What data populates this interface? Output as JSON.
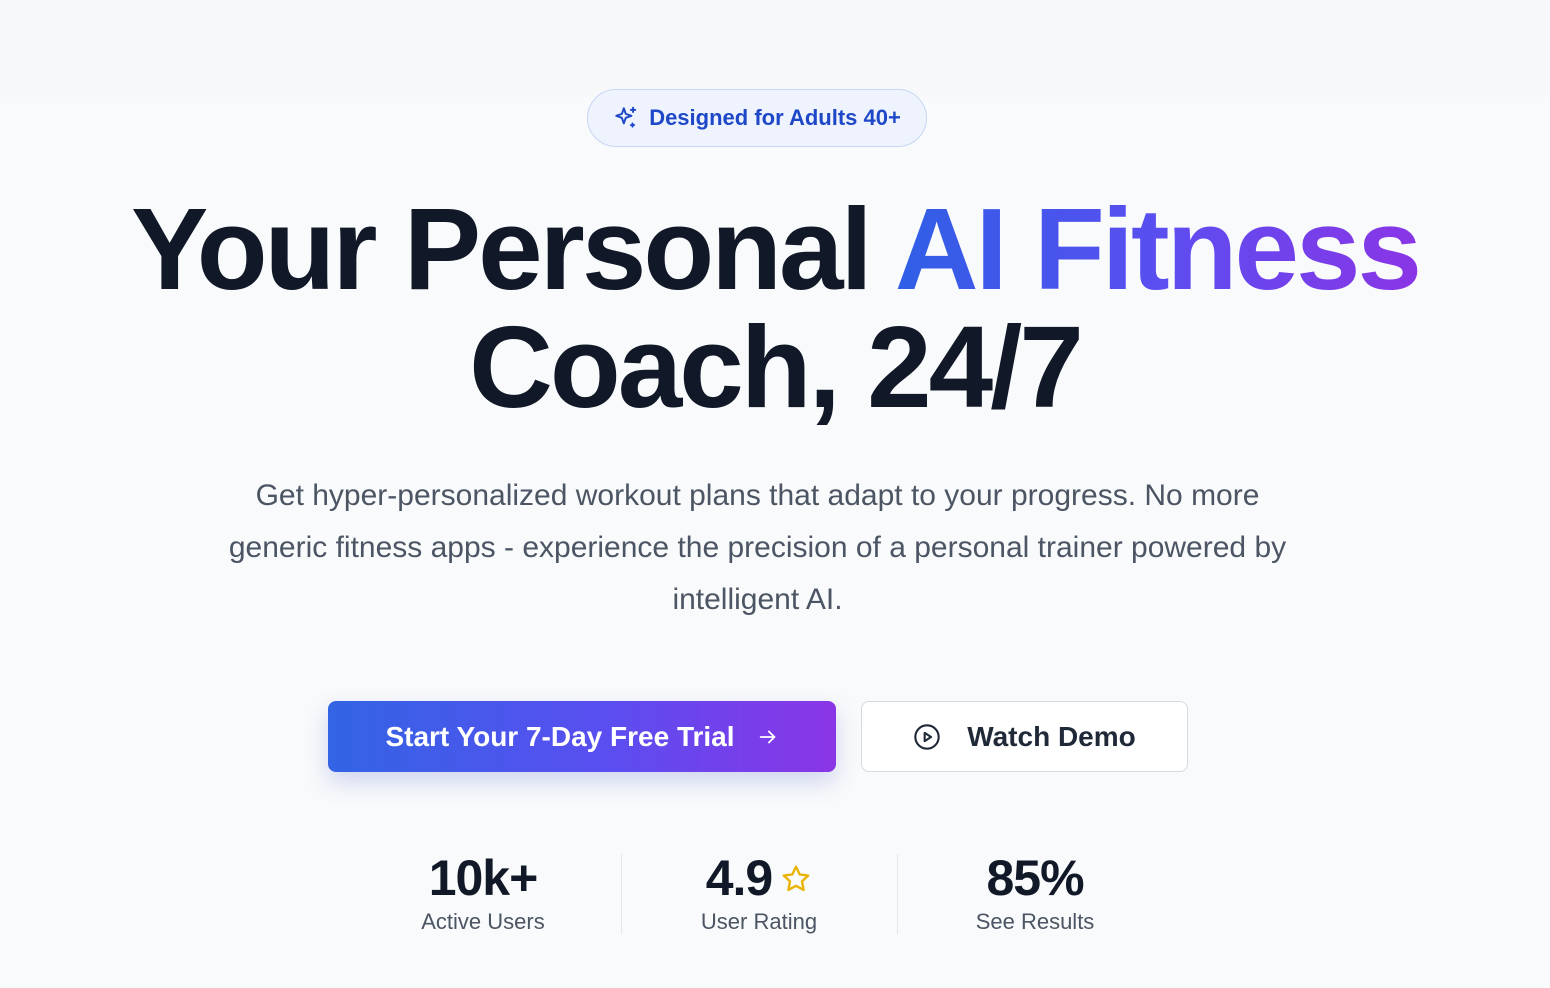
{
  "badge": {
    "icon": "sparkles-icon",
    "label": "Designed for Adults 40+"
  },
  "headline": {
    "line1_plain": "Your Personal ",
    "line1_highlight": "AI Fitness",
    "line2": "Coach, 24/7"
  },
  "subtext": "Get hyper-personalized workout plans that adapt to your progress. No more generic fitness apps - experience the precision of a personal trainer powered by intelligent AI.",
  "cta": {
    "primary_label": "Start Your 7-Day Free Trial",
    "primary_icon": "arrow-right-icon",
    "secondary_label": "Watch Demo",
    "secondary_icon": "play-circle-icon"
  },
  "stats": [
    {
      "value": "10k+",
      "label": "Active Users"
    },
    {
      "value": "4.9",
      "label": "User Rating",
      "icon": "star-icon"
    },
    {
      "value": "85%",
      "label": "See Results"
    }
  ],
  "colors": {
    "background": "#f9fafb",
    "headline": "#111827",
    "accent_blue": "#2f5fe6",
    "accent_purple": "#8a35e6",
    "badge_text": "#1e48c8",
    "star": "#eab308"
  }
}
